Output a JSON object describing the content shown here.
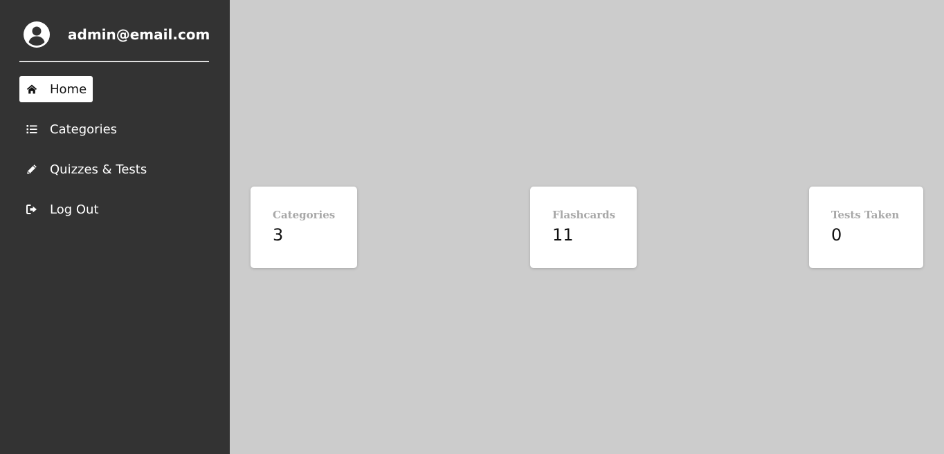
{
  "user": {
    "email": "admin@email.com"
  },
  "sidebar": {
    "items": [
      {
        "label": "Home",
        "icon": "home-icon",
        "active": true
      },
      {
        "label": "Categories",
        "icon": "list-icon",
        "active": false
      },
      {
        "label": "Quizzes & Tests",
        "icon": "pencil-icon",
        "active": false
      },
      {
        "label": "Log Out",
        "icon": "logout-icon",
        "active": false
      }
    ]
  },
  "stats": [
    {
      "label": "Categories",
      "value": "3"
    },
    {
      "label": "Flashcards",
      "value": "11"
    },
    {
      "label": "Tests Taken",
      "value": "0"
    }
  ],
  "colors": {
    "sidebar_bg": "#333333",
    "main_bg": "#cccccc",
    "card_bg": "#ffffff",
    "card_label": "#a8a8a8"
  }
}
